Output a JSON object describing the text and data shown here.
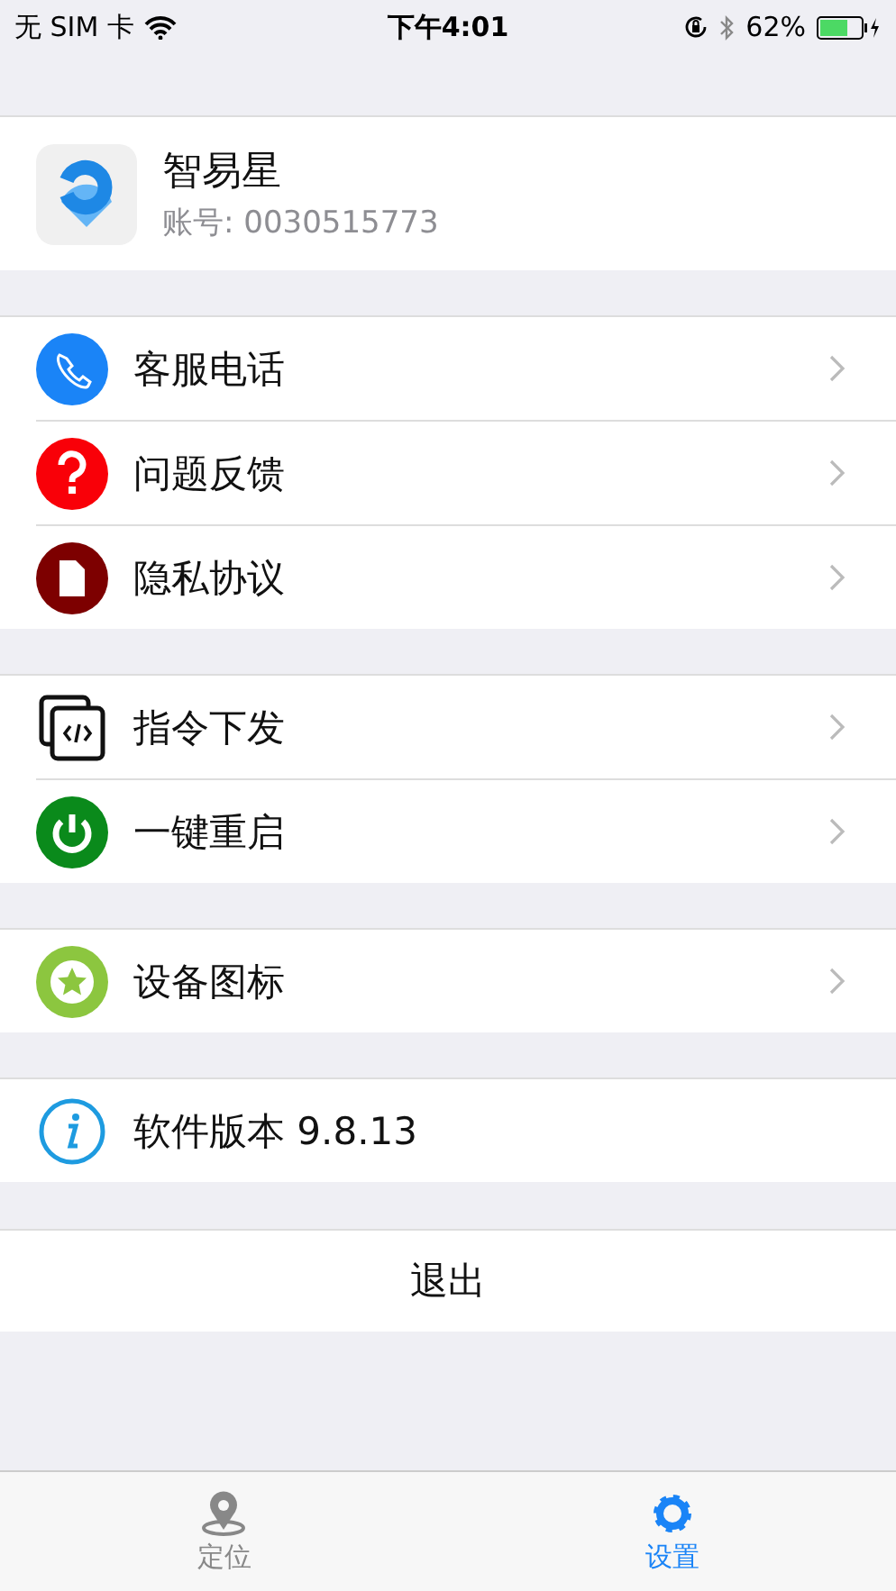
{
  "status_bar": {
    "carrier": "无 SIM 卡",
    "time": "下午4:01",
    "battery": "62%"
  },
  "profile": {
    "name": "智易星",
    "account": "账号: 0030515773"
  },
  "groups": [
    {
      "items": [
        {
          "kind": "phone",
          "label": "客服电话",
          "chevron": true
        },
        {
          "kind": "question",
          "label": "问题反馈",
          "chevron": true
        },
        {
          "kind": "document",
          "label": "隐私协议",
          "chevron": true
        }
      ]
    },
    {
      "items": [
        {
          "kind": "code",
          "label": "指令下发",
          "chevron": true
        },
        {
          "kind": "power",
          "label": "一键重启",
          "chevron": true
        }
      ]
    },
    {
      "items": [
        {
          "kind": "star",
          "label": "设备图标",
          "chevron": true
        }
      ]
    },
    {
      "items": [
        {
          "kind": "info",
          "label": "软件版本 9.8.13",
          "chevron": false
        }
      ]
    }
  ],
  "logout": "退出",
  "tabs": [
    {
      "kind": "location",
      "label": "定位",
      "selected": false
    },
    {
      "kind": "settings",
      "label": "设置",
      "selected": true
    }
  ]
}
